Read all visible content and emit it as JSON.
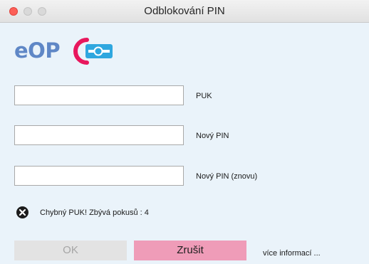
{
  "window": {
    "title": "Odblokování PIN"
  },
  "logo": {
    "text": "eOP",
    "mark_icon": "eop-card-logo-icon",
    "text_color": "#5f87c6",
    "accent_color": "#e8175d"
  },
  "form": {
    "fields": [
      {
        "label": "PUK",
        "value": "",
        "placeholder": ""
      },
      {
        "label": "Nový PIN",
        "value": "",
        "placeholder": ""
      },
      {
        "label": "Nový PIN (znovu)",
        "value": "",
        "placeholder": ""
      }
    ]
  },
  "status": {
    "icon": "error-x-icon",
    "message": "Chybný PUK! Zbývá pokusů : 4"
  },
  "buttons": {
    "ok_label": "OK",
    "cancel_label": "Zrušit",
    "more_info_label": "více informací ..."
  }
}
